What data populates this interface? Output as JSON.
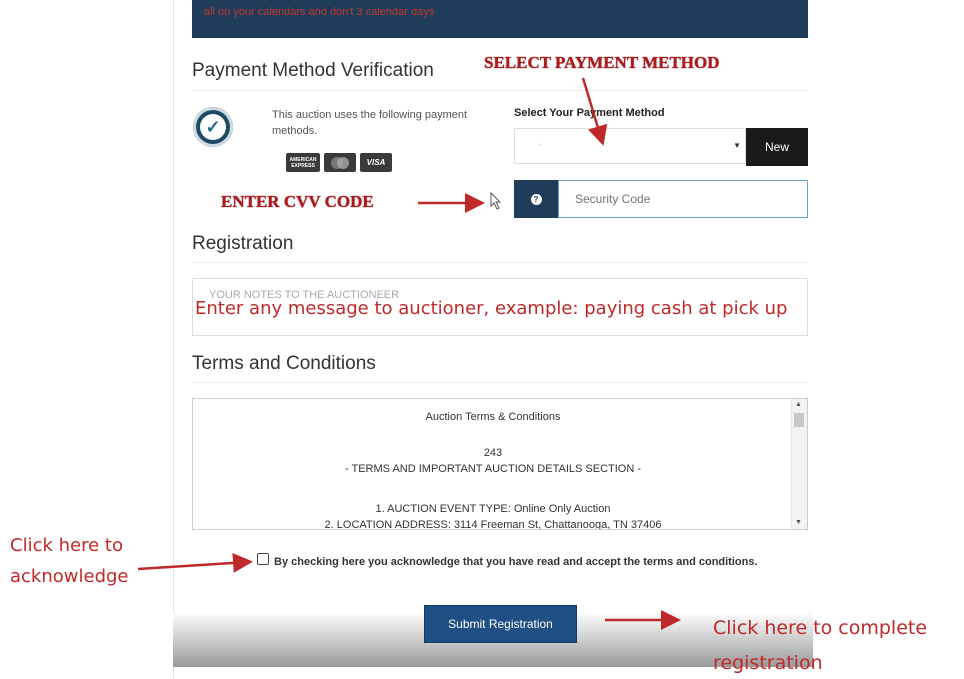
{
  "banner": {
    "text": "all on your calendars and don't 3 calendar days"
  },
  "payment": {
    "heading": "Payment Method Verification",
    "methods_text": "This auction uses the following payment methods.",
    "cards": [
      "AMERICAN EXPRESS",
      "mastercard",
      "VISA"
    ],
    "select_label": "Select Your Payment Method",
    "select_value": "-",
    "new_button": "New",
    "cvv_placeholder": "Security Code",
    "help_icon": "question-icon"
  },
  "registration": {
    "heading": "Registration",
    "notes_placeholder": "YOUR NOTES TO THE AUCTIONEER"
  },
  "terms": {
    "heading": "Terms and Conditions",
    "lines": [
      "Auction Terms & Conditions",
      "",
      "243",
      "- TERMS AND IMPORTANT AUCTION DETAILS SECTION -",
      "",
      "1. AUCTION EVENT TYPE: Online Only Auction",
      "2. LOCATION ADDRESS: 3114 Freeman St, Chattanooga, TN 37406"
    ],
    "acknowledge": "By checking here you acknowledge that you have read and accept the terms and conditions."
  },
  "submit_label": "Submit Registration",
  "annotations": {
    "select_method": "SELECT PAYMENT METHOD",
    "enter_cvv": "ENTER CVV CODE",
    "message": "Enter any message to auctioner, example: paying cash at pick up",
    "click_ack_1": "Click here to",
    "click_ack_2": "acknowledge",
    "click_complete_1": "Click here to complete",
    "click_complete_2": "registration"
  },
  "colors": {
    "navy": "#1f3c5a",
    "button_blue": "#1f4f84",
    "annotation_red": "#c0292a"
  }
}
